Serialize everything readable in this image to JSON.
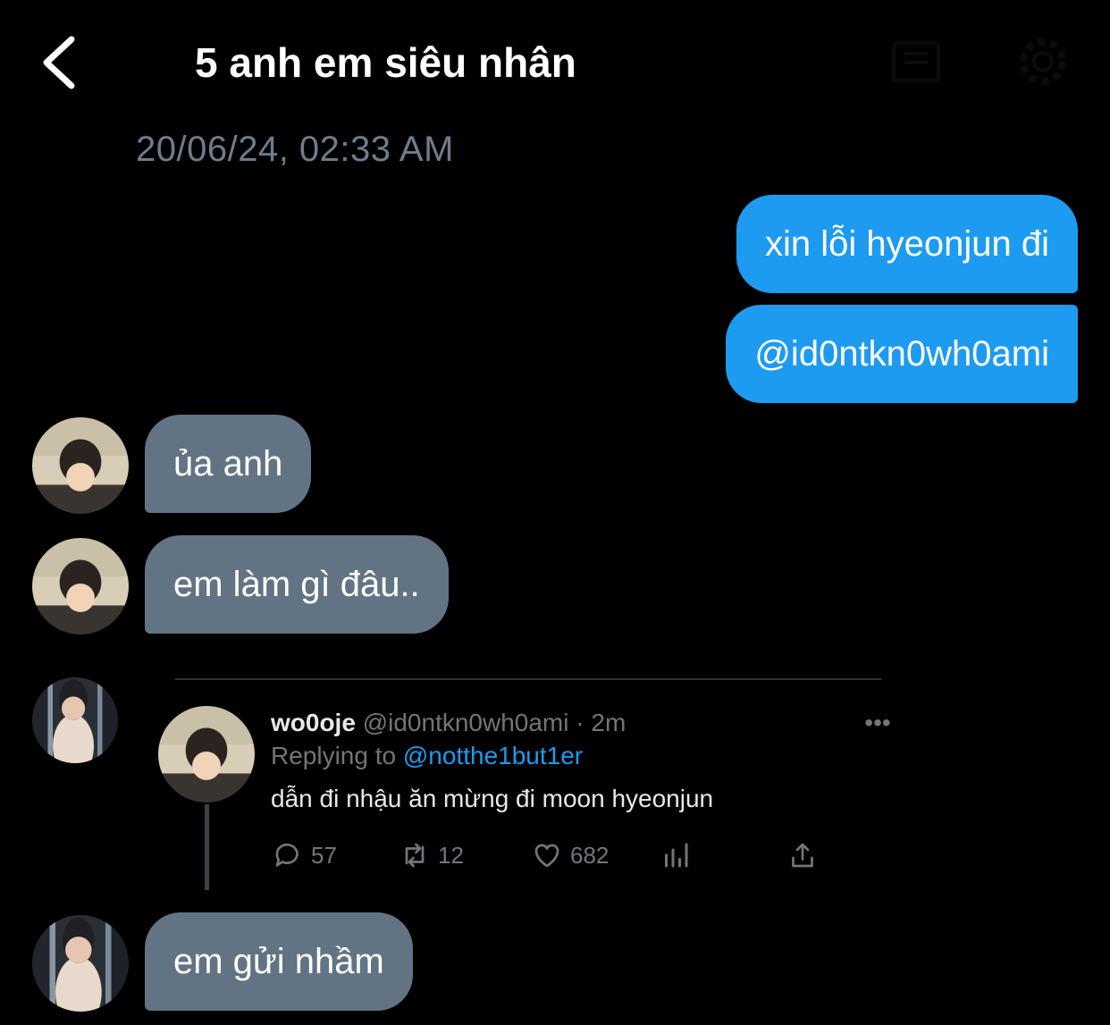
{
  "header": {
    "title": "5 anh em siêu nhân",
    "back_icon": "chevron-left-icon",
    "info_icon": "info-icon",
    "settings_icon": "gear-icon"
  },
  "thread": {
    "timestamp": "20/06/24, 02:33 AM"
  },
  "messages": {
    "sent": [
      "xin lỗi hyeonjun đi",
      "@id0ntkn0wh0ami"
    ],
    "received": [
      "ủa anh",
      "em làm gì đâu..",
      "em gửi nhầm"
    ]
  },
  "shared_tweet": {
    "display_name": "wo0oje",
    "handle": "@id0ntkn0wh0ami",
    "time": "· 2m",
    "replying_label": "Replying to",
    "replying_handle": "@notthe1but1er",
    "text": "dẫn đi nhậu ăn mừng đi moon hyeonjun",
    "more_label": "•••",
    "replies": "57",
    "retweets": "12",
    "likes": "682"
  },
  "colors": {
    "background": "#000000",
    "sent_bubble": "#1d9bf0",
    "received_bubble": "#627384",
    "muted_text": "#71767b",
    "link": "#1d9bf0"
  }
}
